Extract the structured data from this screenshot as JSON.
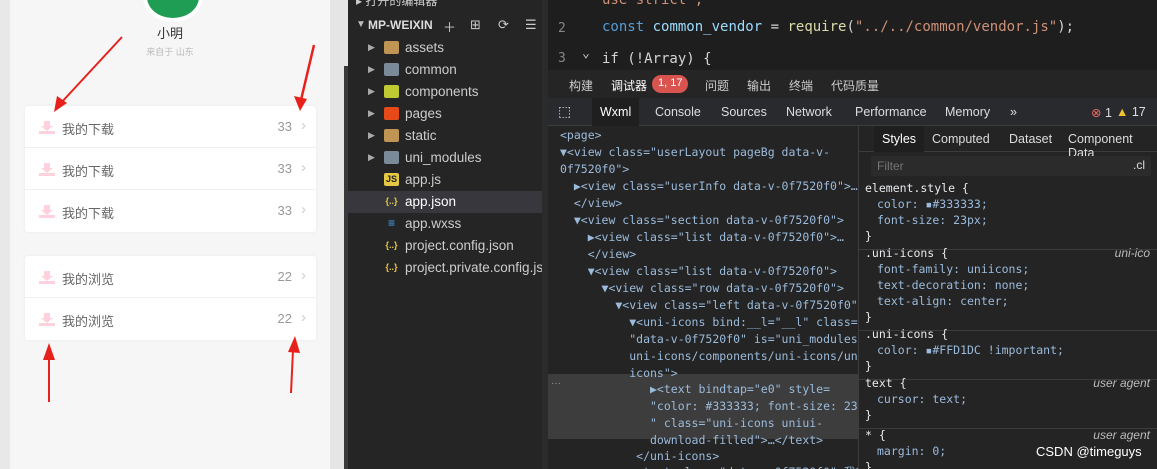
{
  "profile": {
    "name": "小明",
    "from": "来自于 山东"
  },
  "downloads": [
    {
      "label": "我的下载",
      "count": "33"
    },
    {
      "label": "我的下载",
      "count": "33"
    },
    {
      "label": "我的下载",
      "count": "33"
    }
  ],
  "history": [
    {
      "label": "我的浏览",
      "count": "22"
    },
    {
      "label": "我的浏览",
      "count": "22"
    }
  ],
  "explorer": {
    "opened_label": "打开的编辑器",
    "project_title": "MP-WEIXIN",
    "items": [
      {
        "name": "assets",
        "type": "folder"
      },
      {
        "name": "common",
        "type": "folder"
      },
      {
        "name": "components",
        "type": "folder"
      },
      {
        "name": "pages",
        "type": "folder"
      },
      {
        "name": "static",
        "type": "folder"
      },
      {
        "name": "uni_modules",
        "type": "folder"
      },
      {
        "name": "app.js",
        "type": "js"
      },
      {
        "name": "app.json",
        "type": "json"
      },
      {
        "name": "app.wxss",
        "type": "css"
      },
      {
        "name": "project.config.json",
        "type": "json"
      },
      {
        "name": "project.private.config.js...",
        "type": "json"
      }
    ]
  },
  "editor": {
    "line1": "use strict\";",
    "line2_kw": "const",
    "line2_var": "common_vendor",
    "line2_fn": "require",
    "line2_str": "\"../../common/vendor.js\"",
    "line3": "if (!Array) {",
    "ln2": "2",
    "ln3": "3"
  },
  "panel_tabs": [
    "构建",
    "调试器",
    "问题",
    "输出",
    "终端",
    "代码质量"
  ],
  "debugger_badge": "1, 17",
  "devtools_tabs": [
    "Wxml",
    "Console",
    "Sources",
    "Network",
    "Performance",
    "Memory",
    "»"
  ],
  "devtools_counts": {
    "errors": "1",
    "warnings": "17"
  },
  "wxml_lines": [
    "<page>",
    "▼<view class=\"userLayout pageBg data-v-",
    "0f7520f0\">",
    "  ▶<view class=\"userInfo data-v-0f7520f0\">…",
    "  </view>",
    "  ▼<view class=\"section data-v-0f7520f0\">",
    "    ▶<view class=\"list data-v-0f7520f0\">…",
    "    </view>",
    "    ▼<view class=\"list data-v-0f7520f0\">",
    "      ▼<view class=\"row data-v-0f7520f0\">",
    "        ▼<view class=\"left data-v-0f7520f0\">",
    "          ▼<uni-icons bind:__l=\"__l\" class=",
    "          \"data-v-0f7520f0\" is=\"uni_modules/",
    "          uni-icons/components/uni-icons/uni-",
    "          icons\">",
    "             ▶<text bindtap=\"e0\" style=",
    "             \"color: #333333; font-size: 23px;",
    "             \" class=\"uni-icons uniui-",
    "             download-filled\">…</text>",
    "           </uni-icons>",
    "           <text class=\"data-v-0f7520f0\">我的"
  ],
  "styles_tabs": [
    "Styles",
    "Computed",
    "Dataset",
    "Component Data"
  ],
  "filter_placeholder": "Filter",
  "filter_cls": ".cl",
  "rules": [
    {
      "selector": "element.style {",
      "src": "",
      "props": [
        "color: ▪#333333;",
        "font-size: 23px;"
      ]
    },
    {
      "selector": ".uni-icons {",
      "src": "uni-ico",
      "props": [
        "font-family: uniicons;",
        "text-decoration: none;",
        "text-align: center;"
      ]
    },
    {
      "selector": ".uni-icons {",
      "src": "",
      "props": [
        "color: ▪#FFD1DC !important;"
      ]
    },
    {
      "selector": "text {",
      "src": "user agent",
      "props": [
        "cursor: text;"
      ]
    },
    {
      "selector": "* {",
      "src": "user agent",
      "props": [
        "margin: 0;"
      ]
    }
  ],
  "watermark": "CSDN @timeguys",
  "colors": {
    "icon_pink": "#FFD1DC",
    "arrow_red": "#e8201c",
    "avatar_green": "#1f9d55"
  }
}
